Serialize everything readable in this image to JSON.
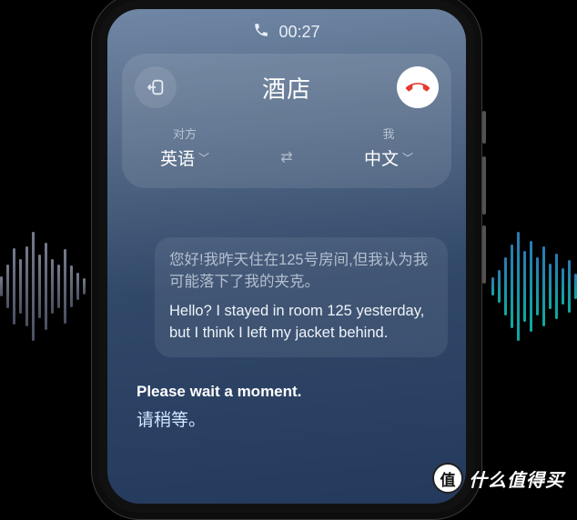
{
  "status": {
    "duration": "00:27"
  },
  "header": {
    "title": "酒店"
  },
  "languages": {
    "other": {
      "label": "对方",
      "value": "英语"
    },
    "me": {
      "label": "我",
      "value": "中文"
    }
  },
  "messages": {
    "incoming": {
      "original": "您好!我昨天住在125号房间,但我认为我可能落下了我的夹克。",
      "translated": "Hello? I stayed in room 125 yesterday, but I think I left my jacket behind."
    },
    "outgoing": {
      "original": "Please wait a moment.",
      "translated": "请稍等。"
    }
  },
  "watermark": {
    "badge": "值",
    "text": "什么值得买"
  }
}
